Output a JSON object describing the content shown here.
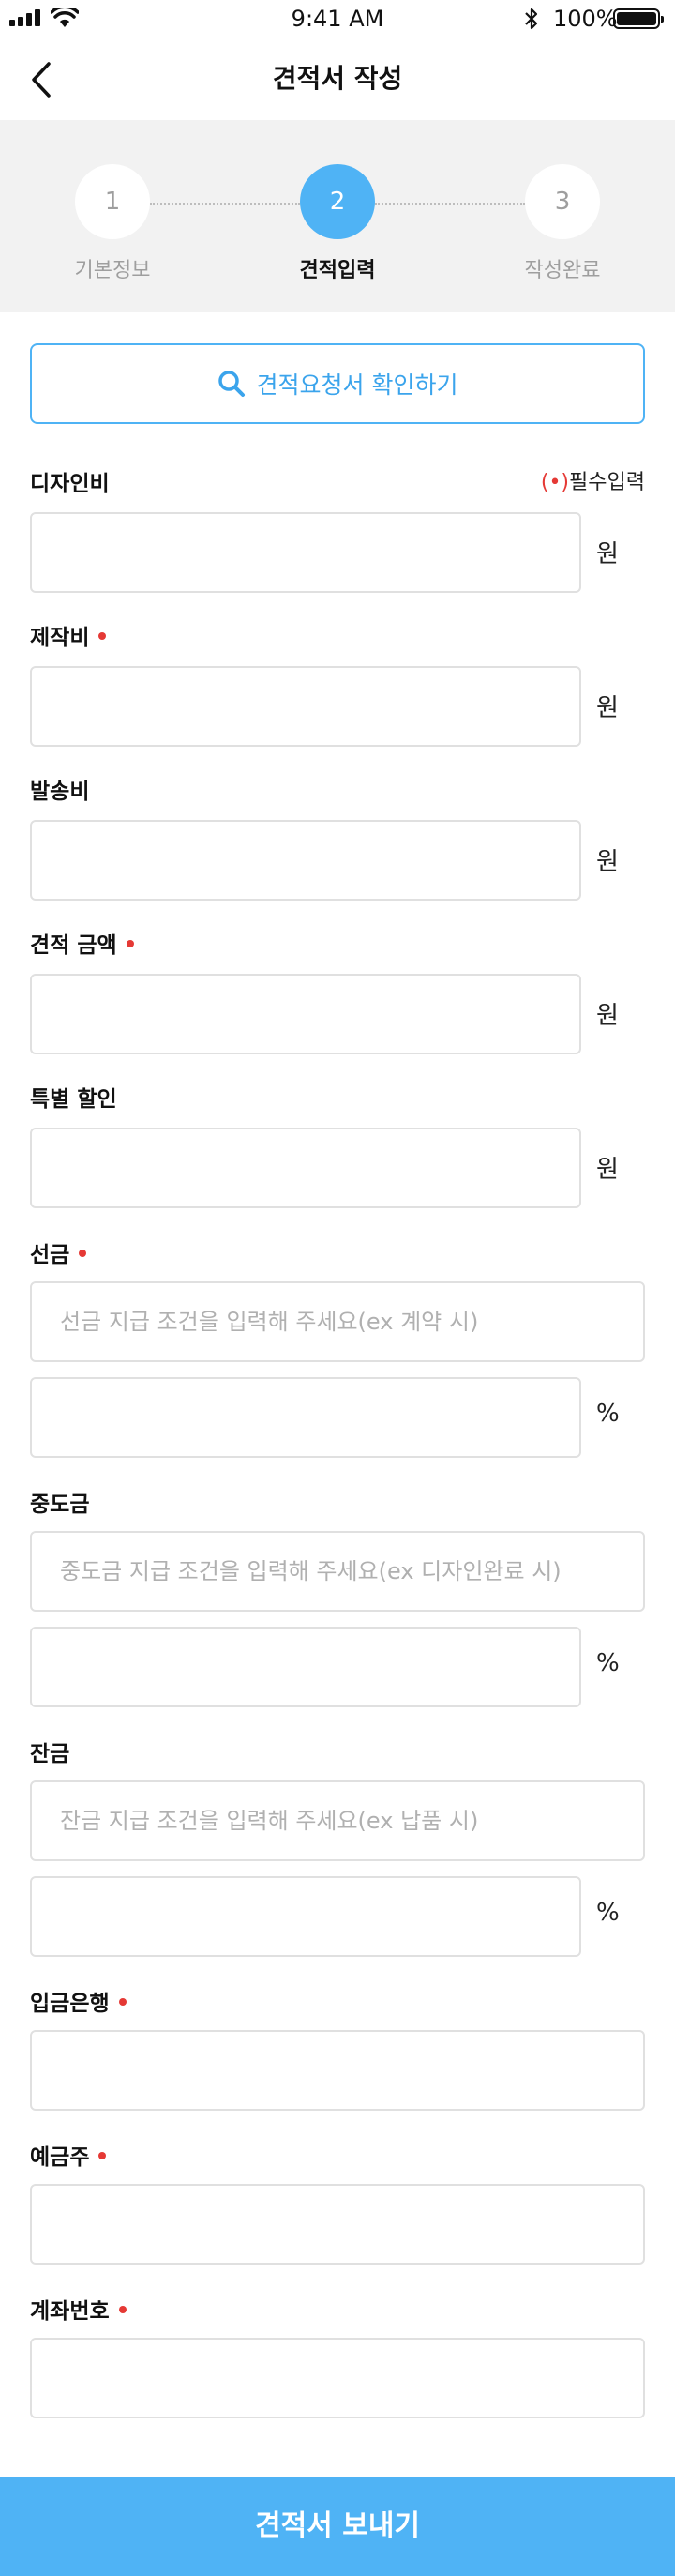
{
  "status": {
    "time": "9:41 AM",
    "battery": "100%"
  },
  "header": {
    "title": "견적서 작성"
  },
  "steps": [
    {
      "num": "1",
      "label": "기본정보",
      "state": "done"
    },
    {
      "num": "2",
      "label": "견적입력",
      "state": "active"
    },
    {
      "num": "3",
      "label": "작성완료",
      "state": "pending"
    }
  ],
  "check_button": {
    "label": "견적요청서 확인하기"
  },
  "required_note": {
    "mark": "(•)",
    "text": "필수입력"
  },
  "fields": {
    "design_fee": {
      "label": "디자인비",
      "unit": "원"
    },
    "production_fee": {
      "label": "제작비",
      "unit": "원"
    },
    "shipping_fee": {
      "label": "발송비",
      "unit": "원"
    },
    "quote_amount": {
      "label": "견적 금액",
      "unit": "원"
    },
    "special_discount": {
      "label": "특별 할인",
      "unit": "원"
    },
    "advance": {
      "label": "선금",
      "placeholder": "선금 지급 조건을 입력해 주세요(ex 계약 시)",
      "unit": "%"
    },
    "interim": {
      "label": "중도금",
      "placeholder": "중도금 지급 조건을 입력해 주세요(ex 디자인완료 시)",
      "unit": "%"
    },
    "balance": {
      "label": "잔금",
      "placeholder": "잔금 지급 조건을 입력해 주세요(ex 납품 시)",
      "unit": "%"
    },
    "bank": {
      "label": "입금은행"
    },
    "account_holder": {
      "label": "예금주"
    },
    "account_number": {
      "label": "계좌번호"
    }
  },
  "submit": {
    "label": "견적서 보내기"
  },
  "colors": {
    "accent": "#4fb3f5",
    "required": "#e53935",
    "stepper_bg": "#f2f2f2"
  }
}
